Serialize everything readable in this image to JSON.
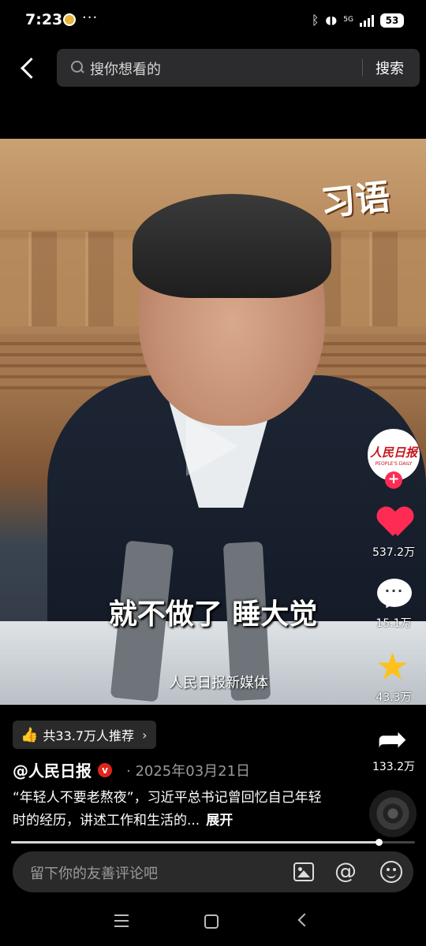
{
  "status_bar": {
    "time": "7:23",
    "dots": "···",
    "network": "5G",
    "battery": "53"
  },
  "search": {
    "placeholder": "搜你想看的",
    "submit_label": "搜索"
  },
  "video": {
    "brand_calligraphy": "习语",
    "subtitle": "就不做了 睡大觉",
    "watermark": "人民日报新媒体",
    "state": "paused"
  },
  "rail": {
    "avatar_name": "人民日报",
    "avatar_sub": "PEOPLE'S DAILY",
    "follow_symbol": "+",
    "likes": "537.2万",
    "comments": "15.1万",
    "favorites": "43.3万",
    "shares": "133.2万"
  },
  "info": {
    "recommend": "共33.7万人推荐",
    "author": "@人民日报",
    "verified_mark": "v",
    "date": "· 2025年03月21日",
    "caption": "“年轻人不要老熬夜”，习近平总书记曾回忆自己年轻时的经历，讲述工作和生活的...",
    "expand": "展开"
  },
  "progress": {
    "fraction": 0.91
  },
  "comment_input": {
    "placeholder": "留下你的友善评论吧"
  },
  "colors": {
    "like": "#fe2c55",
    "favorite": "#fcc21b",
    "verified": "#e0241b"
  }
}
